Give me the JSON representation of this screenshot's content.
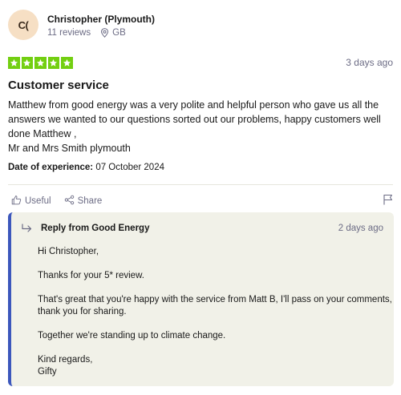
{
  "consumer": {
    "initials": "C(",
    "name": "Christopher (Plymouth)",
    "reviews": "11 reviews",
    "country": "GB",
    "avatar_color": "#f6dfc4"
  },
  "review": {
    "rating": 5,
    "star_color": "#73cf11",
    "date": "3 days ago",
    "title": "Customer service",
    "body_lines": [
      "Matthew from good energy was a very polite and helpful person who gave us all the",
      "answers we wanted to our questions sorted out our problems, happy customers well",
      "done Matthew ,",
      "Mr and Mrs Smith plymouth"
    ],
    "experience_label": "Date of experience:",
    "experience_date": "07 October 2024"
  },
  "actions": {
    "useful_label": "Useful",
    "share_label": "Share"
  },
  "reply": {
    "title": "Reply from Good Energy",
    "date": "2 days ago",
    "accent_color": "#3c57bc",
    "greeting": "Hi Christopher,",
    "line1": "Thanks for your 5* review.",
    "line2a": "That's great that you're happy with the service from Matt B, I'll pass on your comments,",
    "line2b": "thank you for sharing.",
    "line3": "Together we're standing up to climate change.",
    "signoff1": "Kind regards,",
    "signoff2": "Gifty"
  },
  "icons": {
    "location": "map-pin-icon",
    "useful": "thumbs-up-icon",
    "share": "share-icon",
    "flag": "flag-icon",
    "reply": "reply-arrow-icon",
    "star": "star-icon"
  }
}
